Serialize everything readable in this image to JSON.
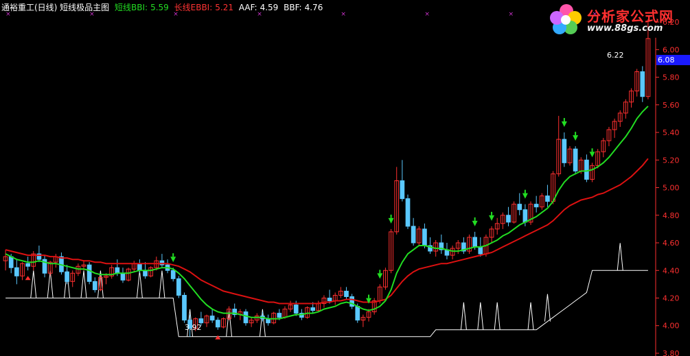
{
  "header": {
    "stock_title": "通裕重工(日线) 短线极品主图",
    "short_label": "短线BBI:",
    "short_value": "5.59",
    "long_label": "长线EBBI:",
    "long_value": "5.21",
    "aaf_label": "AAF:",
    "aaf_value": "4.59",
    "bbf_label": "BBF:",
    "bbf_value": "4.76"
  },
  "logo": {
    "name": "分析家公式网",
    "url": "www.88gs.com"
  },
  "colors": {
    "background": "#000000",
    "up_candle": "#ff3030",
    "down_candle": "#5ac8ff",
    "short_line": "#22dd22",
    "long_line": "#dd1111",
    "indicator_line": "#ffffff",
    "axis": "#ff3030",
    "buy_arrow": "#22dd22",
    "marker": "#cc33cc",
    "current_price_box": "#1a1aff"
  },
  "annotations": {
    "high_label": "6.22",
    "low_label": "3.92",
    "current_price": "6.08"
  },
  "chart_data": {
    "type": "candlestick",
    "ylim": [
      3.78,
      6.26
    ],
    "y_ticks": [
      "6.20",
      "6.00",
      "5.80",
      "5.60",
      "5.40",
      "5.20",
      "5.00",
      "4.80",
      "4.60",
      "4.40",
      "4.20",
      "4.00",
      "3.80"
    ],
    "y_tick_values": [
      6.2,
      6.0,
      5.8,
      5.6,
      5.4,
      5.2,
      5.0,
      4.8,
      4.6,
      4.4,
      4.2,
      4.0,
      3.8
    ],
    "candles": [
      [
        4.47,
        4.55,
        4.4,
        4.5
      ],
      [
        4.5,
        4.52,
        4.38,
        4.42
      ],
      [
        4.42,
        4.48,
        4.3,
        4.36
      ],
      [
        4.36,
        4.46,
        4.33,
        4.45
      ],
      [
        4.45,
        4.5,
        4.4,
        4.43
      ],
      [
        4.43,
        4.54,
        4.4,
        4.52
      ],
      [
        4.52,
        4.58,
        4.46,
        4.48
      ],
      [
        4.48,
        4.51,
        4.35,
        4.38
      ],
      [
        4.38,
        4.47,
        4.36,
        4.46
      ],
      [
        4.46,
        4.52,
        4.42,
        4.5
      ],
      [
        4.5,
        4.53,
        4.37,
        4.39
      ],
      [
        4.39,
        4.44,
        4.3,
        4.32
      ],
      [
        4.32,
        4.4,
        4.28,
        4.38
      ],
      [
        4.38,
        4.45,
        4.36,
        4.43
      ],
      [
        4.43,
        4.47,
        4.4,
        4.44
      ],
      [
        4.44,
        4.46,
        4.3,
        4.32
      ],
      [
        4.32,
        4.35,
        4.24,
        4.26
      ],
      [
        4.26,
        4.36,
        4.25,
        4.35
      ],
      [
        4.35,
        4.38,
        4.3,
        4.36
      ],
      [
        4.36,
        4.44,
        4.34,
        4.42
      ],
      [
        4.42,
        4.48,
        4.36,
        4.38
      ],
      [
        4.38,
        4.42,
        4.31,
        4.33
      ],
      [
        4.33,
        4.42,
        4.32,
        4.41
      ],
      [
        4.41,
        4.47,
        4.39,
        4.45
      ],
      [
        4.45,
        4.48,
        4.38,
        4.4
      ],
      [
        4.4,
        4.46,
        4.34,
        4.36
      ],
      [
        4.36,
        4.43,
        4.35,
        4.42
      ],
      [
        4.42,
        4.5,
        4.4,
        4.47
      ],
      [
        4.47,
        4.52,
        4.42,
        4.44
      ],
      [
        4.44,
        4.48,
        4.38,
        4.4
      ],
      [
        4.4,
        4.42,
        4.32,
        4.34
      ],
      [
        4.34,
        4.36,
        4.2,
        4.22
      ],
      [
        4.22,
        4.24,
        4.02,
        4.04
      ],
      [
        4.04,
        4.08,
        3.92,
        3.98
      ],
      [
        3.98,
        4.06,
        3.96,
        4.05
      ],
      [
        4.05,
        4.1,
        4.0,
        4.02
      ],
      [
        4.02,
        4.08,
        3.99,
        4.07
      ],
      [
        4.07,
        4.12,
        4.02,
        4.04
      ],
      [
        4.04,
        4.06,
        3.97,
        3.99
      ],
      [
        3.99,
        4.06,
        3.98,
        4.05
      ],
      [
        4.05,
        4.14,
        4.04,
        4.12
      ],
      [
        4.12,
        4.16,
        4.06,
        4.08
      ],
      [
        4.08,
        4.12,
        4.04,
        4.1
      ],
      [
        4.1,
        4.12,
        4.0,
        4.02
      ],
      [
        4.02,
        4.06,
        3.99,
        4.04
      ],
      [
        4.04,
        4.09,
        4.02,
        4.07
      ],
      [
        4.07,
        4.1,
        4.03,
        4.05
      ],
      [
        4.05,
        4.08,
        4.0,
        4.02
      ],
      [
        4.02,
        4.1,
        4.01,
        4.09
      ],
      [
        4.09,
        4.12,
        4.04,
        4.06
      ],
      [
        4.06,
        4.14,
        4.05,
        4.12
      ],
      [
        4.12,
        4.18,
        4.1,
        4.15
      ],
      [
        4.15,
        4.18,
        4.07,
        4.09
      ],
      [
        4.09,
        4.12,
        4.04,
        4.06
      ],
      [
        4.06,
        4.14,
        4.05,
        4.13
      ],
      [
        4.13,
        4.17,
        4.09,
        4.11
      ],
      [
        4.11,
        4.18,
        4.1,
        4.16
      ],
      [
        4.16,
        4.22,
        4.13,
        4.2
      ],
      [
        4.2,
        4.26,
        4.16,
        4.18
      ],
      [
        4.18,
        4.24,
        4.15,
        4.22
      ],
      [
        4.22,
        4.28,
        4.2,
        4.25
      ],
      [
        4.25,
        4.28,
        4.19,
        4.21
      ],
      [
        4.21,
        4.23,
        4.12,
        4.14
      ],
      [
        4.14,
        4.16,
        4.02,
        4.04
      ],
      [
        4.04,
        4.08,
        3.99,
        4.06
      ],
      [
        4.06,
        4.12,
        4.03,
        4.1
      ],
      [
        4.1,
        4.2,
        4.08,
        4.18
      ],
      [
        4.18,
        4.3,
        4.16,
        4.28
      ],
      [
        4.28,
        4.42,
        4.26,
        4.4
      ],
      [
        4.4,
        4.7,
        4.38,
        4.68
      ],
      [
        4.68,
        5.15,
        4.66,
        5.05
      ],
      [
        5.05,
        5.2,
        4.9,
        4.92
      ],
      [
        4.92,
        4.95,
        4.7,
        4.72
      ],
      [
        4.72,
        4.78,
        4.58,
        4.6
      ],
      [
        4.6,
        4.72,
        4.58,
        4.7
      ],
      [
        4.7,
        4.74,
        4.56,
        4.58
      ],
      [
        4.58,
        4.64,
        4.52,
        4.54
      ],
      [
        4.54,
        4.62,
        4.5,
        4.6
      ],
      [
        4.6,
        4.66,
        4.52,
        4.55
      ],
      [
        4.55,
        4.6,
        4.48,
        4.51
      ],
      [
        4.51,
        4.58,
        4.48,
        4.56
      ],
      [
        4.56,
        4.62,
        4.52,
        4.6
      ],
      [
        4.6,
        4.64,
        4.52,
        4.54
      ],
      [
        4.54,
        4.66,
        4.52,
        4.64
      ],
      [
        4.64,
        4.68,
        4.55,
        4.57
      ],
      [
        4.57,
        4.64,
        4.5,
        4.52
      ],
      [
        4.52,
        4.66,
        4.5,
        4.64
      ],
      [
        4.64,
        4.72,
        4.6,
        4.7
      ],
      [
        4.7,
        4.78,
        4.66,
        4.74
      ],
      [
        4.74,
        4.82,
        4.7,
        4.8
      ],
      [
        4.8,
        4.86,
        4.72,
        4.75
      ],
      [
        4.75,
        4.9,
        4.74,
        4.88
      ],
      [
        4.88,
        4.96,
        4.8,
        4.84
      ],
      [
        4.84,
        4.88,
        4.72,
        4.75
      ],
      [
        4.75,
        4.9,
        4.73,
        4.88
      ],
      [
        4.88,
        4.94,
        4.82,
        4.86
      ],
      [
        4.86,
        4.96,
        4.84,
        4.94
      ],
      [
        4.94,
        5.02,
        4.86,
        4.9
      ],
      [
        4.9,
        5.12,
        4.88,
        5.1
      ],
      [
        5.1,
        5.52,
        5.08,
        5.35
      ],
      [
        5.35,
        5.4,
        5.15,
        5.18
      ],
      [
        5.18,
        5.3,
        5.16,
        5.28
      ],
      [
        5.28,
        5.3,
        5.1,
        5.12
      ],
      [
        5.12,
        5.22,
        5.1,
        5.2
      ],
      [
        5.2,
        5.24,
        5.04,
        5.06
      ],
      [
        5.06,
        5.18,
        5.04,
        5.16
      ],
      [
        5.16,
        5.28,
        5.14,
        5.26
      ],
      [
        5.26,
        5.36,
        5.22,
        5.34
      ],
      [
        5.34,
        5.44,
        5.3,
        5.42
      ],
      [
        5.42,
        5.5,
        5.36,
        5.48
      ],
      [
        5.48,
        5.56,
        5.44,
        5.54
      ],
      [
        5.54,
        5.64,
        5.5,
        5.62
      ],
      [
        5.62,
        5.72,
        5.58,
        5.7
      ],
      [
        5.7,
        5.86,
        5.66,
        5.84
      ],
      [
        5.84,
        5.88,
        5.62,
        5.66
      ],
      [
        5.66,
        6.22,
        5.64,
        6.08
      ]
    ],
    "short_bbi": [
      4.52,
      4.5,
      4.48,
      4.47,
      4.46,
      4.46,
      4.47,
      4.46,
      4.45,
      4.45,
      4.44,
      4.43,
      4.42,
      4.41,
      4.41,
      4.4,
      4.38,
      4.37,
      4.37,
      4.37,
      4.38,
      4.38,
      4.38,
      4.39,
      4.4,
      4.4,
      4.4,
      4.41,
      4.42,
      4.42,
      4.41,
      4.38,
      4.34,
      4.29,
      4.24,
      4.19,
      4.15,
      4.12,
      4.1,
      4.09,
      4.09,
      4.09,
      4.08,
      4.07,
      4.06,
      4.06,
      4.06,
      4.05,
      4.05,
      4.05,
      4.06,
      4.07,
      4.08,
      4.08,
      4.09,
      4.09,
      4.1,
      4.12,
      4.13,
      4.14,
      4.16,
      4.17,
      4.16,
      4.14,
      4.12,
      4.11,
      4.12,
      4.14,
      4.18,
      4.26,
      4.38,
      4.46,
      4.52,
      4.55,
      4.58,
      4.58,
      4.57,
      4.56,
      4.56,
      4.55,
      4.54,
      4.54,
      4.55,
      4.56,
      4.57,
      4.57,
      4.58,
      4.6,
      4.62,
      4.65,
      4.67,
      4.7,
      4.73,
      4.75,
      4.77,
      4.79,
      4.82,
      4.85,
      4.9,
      4.98,
      5.04,
      5.08,
      5.1,
      5.12,
      5.12,
      5.13,
      5.15,
      5.18,
      5.22,
      5.27,
      5.32,
      5.37,
      5.43,
      5.5,
      5.55,
      5.59
    ],
    "long_ebbi": [
      4.55,
      4.54,
      4.53,
      4.52,
      4.51,
      4.51,
      4.51,
      4.51,
      4.5,
      4.5,
      4.49,
      4.49,
      4.48,
      4.48,
      4.47,
      4.47,
      4.46,
      4.46,
      4.45,
      4.45,
      4.45,
      4.45,
      4.45,
      4.45,
      4.45,
      4.45,
      4.45,
      4.45,
      4.45,
      4.45,
      4.44,
      4.43,
      4.41,
      4.39,
      4.36,
      4.33,
      4.31,
      4.29,
      4.27,
      4.25,
      4.24,
      4.23,
      4.22,
      4.21,
      4.2,
      4.19,
      4.18,
      4.17,
      4.17,
      4.16,
      4.16,
      4.16,
      4.16,
      4.16,
      4.16,
      4.16,
      4.16,
      4.17,
      4.17,
      4.18,
      4.18,
      4.19,
      4.19,
      4.18,
      4.17,
      4.17,
      4.17,
      4.18,
      4.19,
      4.22,
      4.27,
      4.32,
      4.36,
      4.39,
      4.41,
      4.42,
      4.43,
      4.44,
      4.45,
      4.45,
      4.46,
      4.47,
      4.48,
      4.49,
      4.5,
      4.51,
      4.52,
      4.53,
      4.55,
      4.57,
      4.59,
      4.61,
      4.63,
      4.65,
      4.67,
      4.69,
      4.71,
      4.73,
      4.76,
      4.8,
      4.84,
      4.87,
      4.89,
      4.91,
      4.92,
      4.93,
      4.95,
      4.96,
      4.98,
      5.0,
      5.02,
      5.05,
      5.08,
      5.12,
      5.16,
      5.21
    ],
    "buy_arrow_indices": [
      30,
      65,
      67,
      69,
      84,
      87,
      93,
      100,
      102,
      105
    ],
    "sell_arrow_indices": [
      4,
      38
    ]
  }
}
